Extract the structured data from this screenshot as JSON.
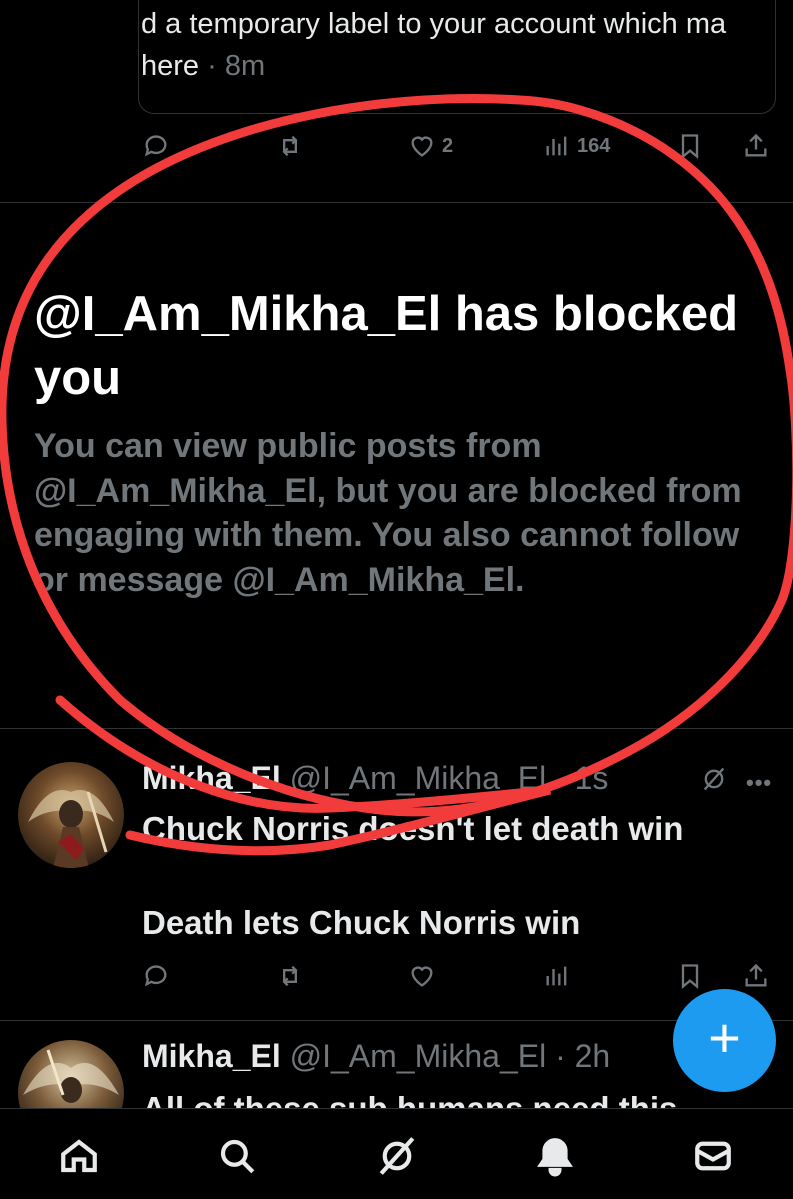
{
  "quote": {
    "line1": "d a temporary label to your account which ma",
    "line2_text": "here",
    "line2_time": " · 8m"
  },
  "prev_post_actions": {
    "likes": "2",
    "views": "164"
  },
  "blocked_notice": {
    "title": "@I_Am_Mikha_El has blocked you",
    "body": "You can view public posts from @I_Am_Mikha_El, but you are blocked from engaging with them. You also cannot follow or message @I_Am_Mikha_El."
  },
  "posts": [
    {
      "name": "Mikha_El",
      "handle": "@I_Am_Mikha_El",
      "time": " · 1s",
      "line1": "Chuck Norris doesn't let death win",
      "line2": "Death lets Chuck Norris win"
    },
    {
      "name": "Mikha_El",
      "handle": "@I_Am_Mikha_El",
      "time": " · 2h",
      "line1": "All of these sub humans need this"
    }
  ],
  "fab": {
    "label": "+"
  },
  "nav_icons": [
    "home-icon",
    "search-icon",
    "grok-icon",
    "notifications-icon",
    "messages-icon"
  ],
  "colors": {
    "background": "#000000",
    "text": "#e7e9ea",
    "muted": "#71767b",
    "accent": "#1d9bf0",
    "annotation": "#f23b3b"
  }
}
